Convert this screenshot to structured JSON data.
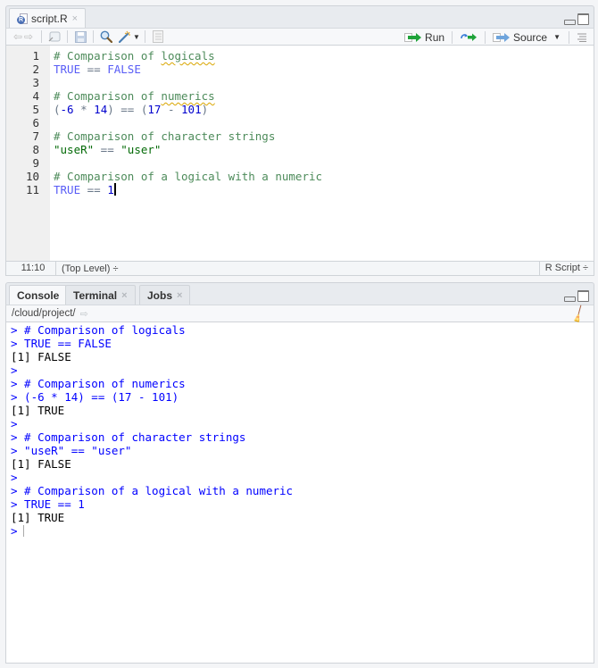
{
  "editor": {
    "tab": {
      "label": "script.R",
      "icon": "r-file-icon",
      "close": "×"
    },
    "toolbar": {
      "run_label": "Run",
      "source_label": "Source",
      "source_dropdown": "▾",
      "icons": [
        "back-icon",
        "forward-icon",
        "show-in-window-icon",
        "save-icon",
        "find-icon",
        "code-tools-icon",
        "compile-report-icon"
      ]
    },
    "lines": [
      {
        "n": "1",
        "tokens": [
          {
            "t": "# Comparison of ",
            "c": "comment"
          },
          {
            "t": "logicals",
            "c": "comment",
            "squig": true
          }
        ]
      },
      {
        "n": "2",
        "tokens": [
          {
            "t": "TRUE",
            "c": "kw"
          },
          {
            "t": " == ",
            "c": "op"
          },
          {
            "t": "FALSE",
            "c": "kw"
          }
        ]
      },
      {
        "n": "3",
        "tokens": []
      },
      {
        "n": "4",
        "tokens": [
          {
            "t": "# Comparison of ",
            "c": "comment"
          },
          {
            "t": "numerics",
            "c": "comment",
            "squig": true
          }
        ]
      },
      {
        "n": "5",
        "tokens": [
          {
            "t": "(",
            "c": "op"
          },
          {
            "t": "-6",
            "c": "num"
          },
          {
            "t": " * ",
            "c": "op"
          },
          {
            "t": "14",
            "c": "num"
          },
          {
            "t": ") == (",
            "c": "op"
          },
          {
            "t": "17",
            "c": "num"
          },
          {
            "t": " - ",
            "c": "op"
          },
          {
            "t": "101",
            "c": "num"
          },
          {
            "t": ")",
            "c": "op"
          }
        ]
      },
      {
        "n": "6",
        "tokens": []
      },
      {
        "n": "7",
        "tokens": [
          {
            "t": "# Comparison of character strings",
            "c": "comment"
          }
        ]
      },
      {
        "n": "8",
        "tokens": [
          {
            "t": "\"useR\"",
            "c": "str"
          },
          {
            "t": " == ",
            "c": "op"
          },
          {
            "t": "\"user\"",
            "c": "str"
          }
        ]
      },
      {
        "n": "9",
        "tokens": []
      },
      {
        "n": "10",
        "tokens": [
          {
            "t": "# Comparison of a logical with a numeric",
            "c": "comment"
          }
        ]
      },
      {
        "n": "11",
        "tokens": [
          {
            "t": "TRUE",
            "c": "kw"
          },
          {
            "t": " == ",
            "c": "op"
          },
          {
            "t": "1",
            "c": "num"
          }
        ],
        "cursor": true
      }
    ],
    "status": {
      "position": "11:10",
      "scope": "(Top Level) ÷",
      "filetype": "R Script ÷"
    }
  },
  "console": {
    "tabs": [
      {
        "label": "Console",
        "active": true
      },
      {
        "label": "Terminal",
        "close": "×"
      },
      {
        "label": "Jobs",
        "close": "×"
      }
    ],
    "path": "/cloud/project/",
    "lines": [
      {
        "text": "> # Comparison of logicals",
        "kind": "in"
      },
      {
        "text": "> TRUE == FALSE",
        "kind": "in"
      },
      {
        "text": "[1] FALSE",
        "kind": "out"
      },
      {
        "text": ">",
        "kind": "in"
      },
      {
        "text": "> # Comparison of numerics",
        "kind": "in"
      },
      {
        "text": "> (-6 * 14) == (17 - 101)",
        "kind": "in"
      },
      {
        "text": "[1] TRUE",
        "kind": "out"
      },
      {
        "text": ">",
        "kind": "in"
      },
      {
        "text": "> # Comparison of character strings",
        "kind": "in"
      },
      {
        "text": "> \"useR\" == \"user\"",
        "kind": "in"
      },
      {
        "text": "[1] FALSE",
        "kind": "out"
      },
      {
        "text": ">",
        "kind": "in"
      },
      {
        "text": "> # Comparison of a logical with a numeric",
        "kind": "in"
      },
      {
        "text": "> TRUE == 1",
        "kind": "in"
      },
      {
        "text": "[1] TRUE",
        "kind": "out"
      },
      {
        "text": ">",
        "kind": "prompt"
      }
    ]
  },
  "colors": {
    "comment": "#4d8b5a",
    "keyword": "#585cf6",
    "number": "#0000cd",
    "string": "#036a07",
    "console_input": "#0000ff",
    "run_arrow": "#1fa33a"
  }
}
